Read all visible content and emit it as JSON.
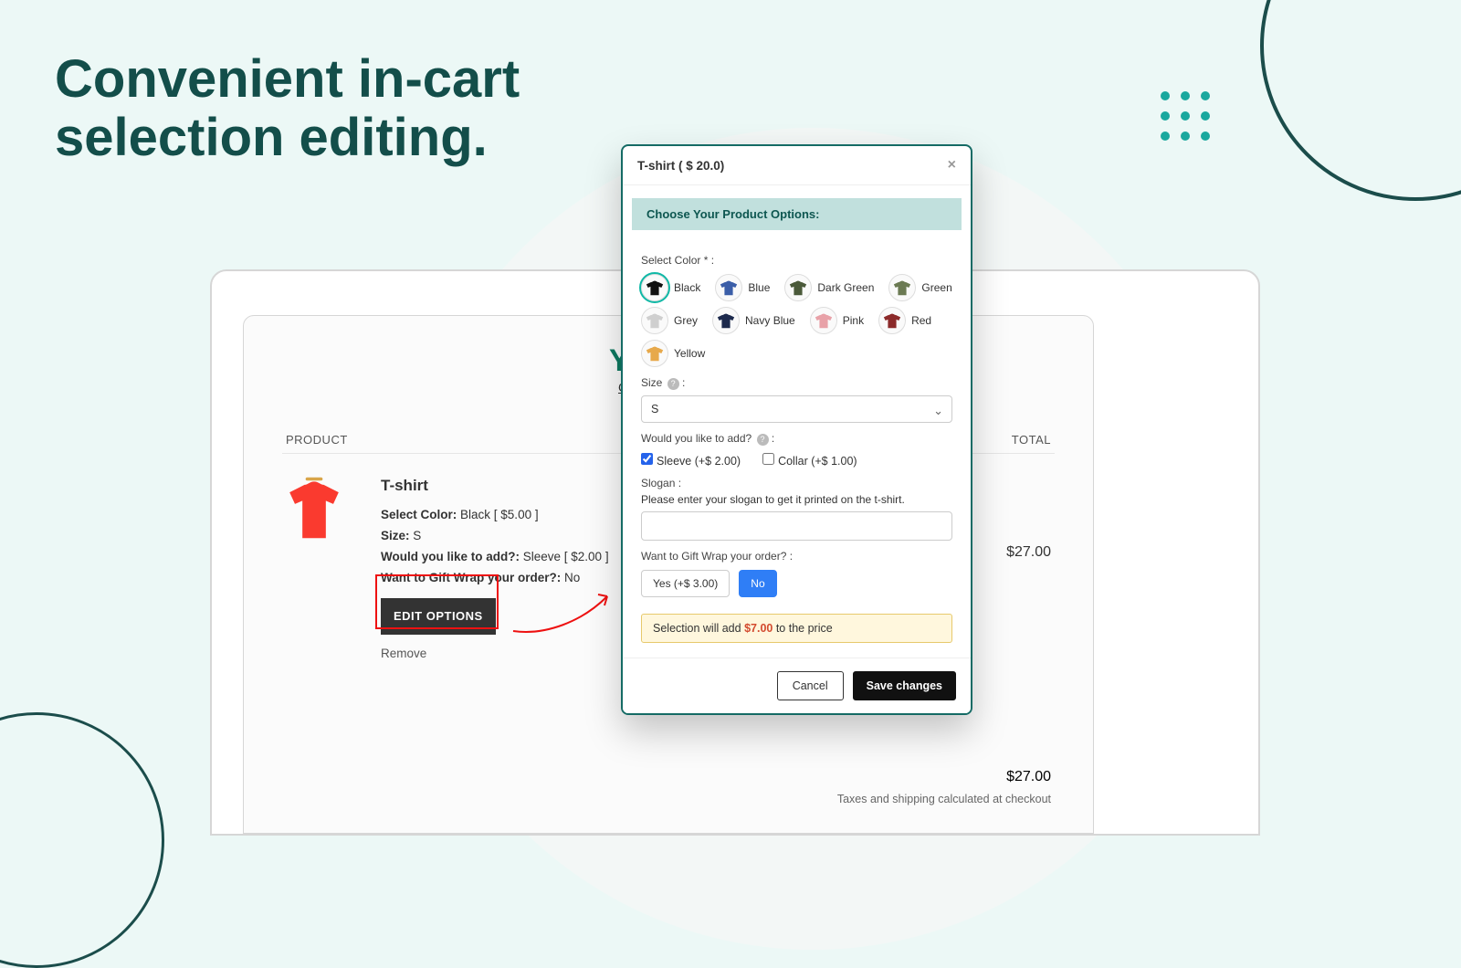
{
  "headline": "Convenient in-cart selection editing.",
  "cart": {
    "title_peek": "Y",
    "continue_peek": "C",
    "col_product": "PRODUCT",
    "col_total": "TOTAL",
    "item": {
      "name": "T-shirt",
      "color_label": "Select Color:",
      "color_value": " Black [ $5.00 ]",
      "size_label": "Size:",
      "size_value": " S",
      "add_label": "Would you like to add?:",
      "add_value": " Sleeve [ $2.00 ]",
      "wrap_label": "Want to Gift Wrap your order?:",
      "wrap_value": " No",
      "edit_btn": "EDIT OPTIONS",
      "remove": "Remove",
      "line_total": "$27.00"
    },
    "subtotal": "$27.00",
    "shipping_note": "Taxes and shipping calculated at checkout"
  },
  "modal": {
    "title": "T-shirt ( $ 20.0)",
    "banner": "Choose Your Product Options:",
    "color_label": "Select Color * :",
    "colors": {
      "black": "Black",
      "blue": "Blue",
      "dark_green": "Dark Green",
      "green": "Green",
      "grey": "Grey",
      "navy_blue": "Navy Blue",
      "pink": "Pink",
      "red": "Red",
      "yellow": "Yellow"
    },
    "color_hex": {
      "black": "#111111",
      "blue": "#3b5ea8",
      "dark_green": "#4b5a3a",
      "green": "#6b7a53",
      "grey": "#cfcfcf",
      "navy_blue": "#1d2a4d",
      "pink": "#e8a1a8",
      "red": "#8c2a2a",
      "yellow": "#e7a94b"
    },
    "size_label": "Size",
    "size_value": "S",
    "addons_label": "Would you like to add?",
    "addon_sleeve": "Sleeve (+$ 2.00)",
    "addon_collar": "Collar (+$ 1.00)",
    "slogan_label": "Slogan :",
    "slogan_hint": "Please enter your slogan to get it printed on the t-shirt.",
    "wrap_label": "Want to Gift Wrap your order? :",
    "wrap_yes": "Yes (+$ 3.00)",
    "wrap_no": "No",
    "price_banner_pre": "Selection will add ",
    "price_banner_amt": "$7.00",
    "price_banner_post": " to the price",
    "cancel": "Cancel",
    "save": "Save changes"
  }
}
